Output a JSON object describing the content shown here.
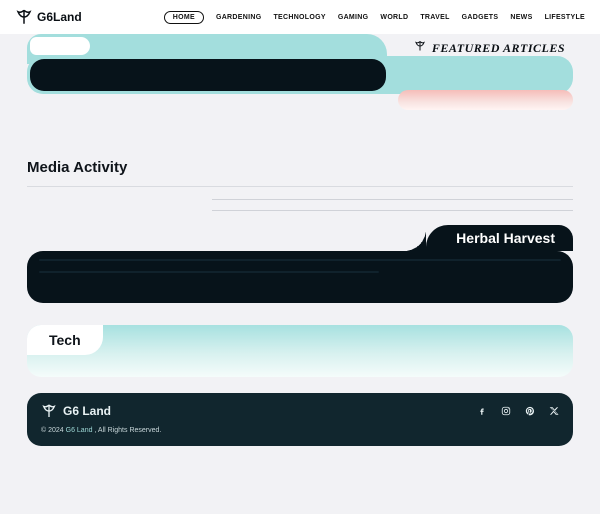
{
  "brand": {
    "name": "G6Land"
  },
  "nav": {
    "items": [
      {
        "label": "HOME",
        "active": true
      },
      {
        "label": "GARDENING"
      },
      {
        "label": "TECHNOLOGY"
      },
      {
        "label": "GAMING"
      },
      {
        "label": "WORLD"
      },
      {
        "label": "TRAVEL"
      },
      {
        "label": "GADGETS"
      },
      {
        "label": "NEWS"
      },
      {
        "label": "LIFESTYLE"
      }
    ]
  },
  "featured": {
    "label": "FEATURED ARTICLES"
  },
  "media": {
    "title": "Media Activity"
  },
  "herbal": {
    "title": "Herbal Harvest"
  },
  "tech": {
    "title": "Tech"
  },
  "footer": {
    "brand": "G6 Land",
    "copyright_prefix": "© 2024 ",
    "site_link": "G6 Land",
    "copyright_suffix": " , All Rights Reserved."
  }
}
